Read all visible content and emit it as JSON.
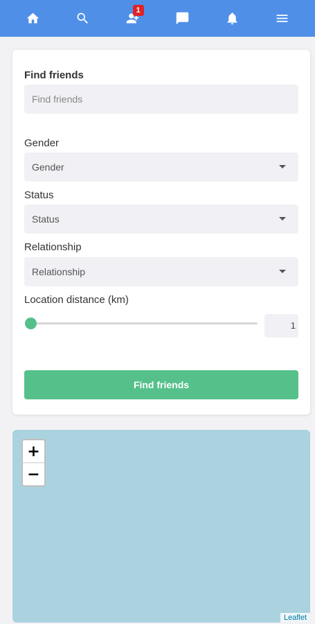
{
  "colors": {
    "topbar": "#4f8fe8",
    "accent": "#55c08a",
    "badge": "#e02424",
    "map_water": "#aad3df"
  },
  "nav": {
    "items": [
      {
        "name": "home",
        "icon": "home-icon"
      },
      {
        "name": "search",
        "icon": "search-icon"
      },
      {
        "name": "friends",
        "icon": "friend-requests-icon",
        "badge": "1"
      },
      {
        "name": "messages",
        "icon": "chat-icon"
      },
      {
        "name": "notifications",
        "icon": "bell-icon"
      },
      {
        "name": "menu",
        "icon": "hamburger-menu-icon"
      }
    ]
  },
  "form": {
    "find_label": "Find friends",
    "find_placeholder": "Find friends",
    "gender_label": "Gender",
    "gender_value": "Gender",
    "status_label": "Status",
    "status_value": "Status",
    "relationship_label": "Relationship",
    "relationship_value": "Relationship",
    "distance_label": "Location distance (km)",
    "distance_value": "1",
    "distance_fraction": 0.0,
    "submit_label": "Find friends"
  },
  "map": {
    "zoom_in": "+",
    "zoom_out": "−",
    "attribution": "Leaflet"
  }
}
